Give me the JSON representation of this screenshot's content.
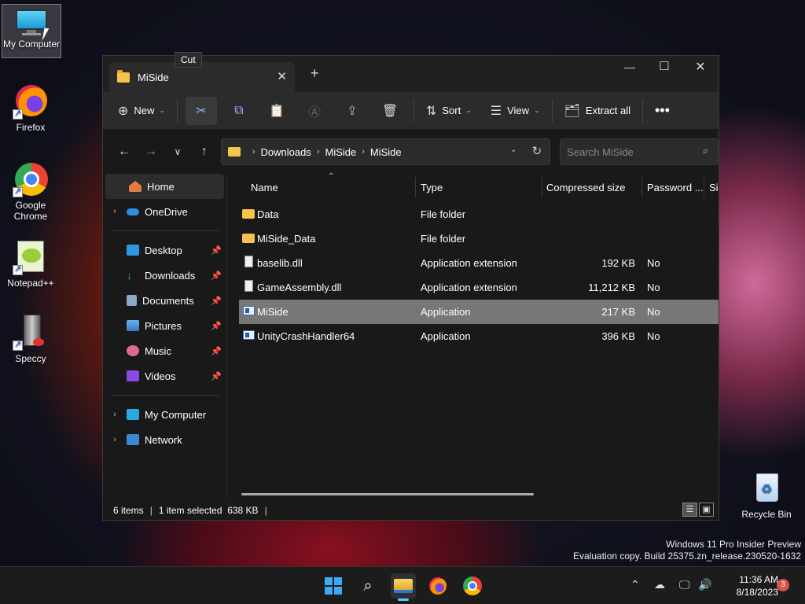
{
  "desktop": {
    "icons": [
      {
        "label": "My Computer"
      },
      {
        "label": "Firefox"
      },
      {
        "label": "Google Chrome"
      },
      {
        "label": "Notepad++"
      },
      {
        "label": "Speccy"
      }
    ],
    "recycle_bin": "Recycle Bin",
    "watermark_line1": "Windows 11 Pro Insider Preview",
    "watermark_line2": "Evaluation copy. Build 25375.zn_release.230520-1632"
  },
  "window": {
    "tab_title": "MiSide",
    "tooltip": "Cut",
    "toolbar": {
      "new_label": "New",
      "sort_label": "Sort",
      "view_label": "View",
      "extract_label": "Extract all"
    },
    "path": [
      "Downloads",
      "MiSide",
      "MiSide"
    ],
    "search_placeholder": "Search MiSide",
    "sidebar": {
      "home": "Home",
      "onedrive": "OneDrive",
      "quick": [
        "Desktop",
        "Downloads",
        "Documents",
        "Pictures",
        "Music",
        "Videos"
      ],
      "my_computer": "My Computer",
      "network": "Network"
    },
    "columns": [
      "Name",
      "Type",
      "Compressed size",
      "Password ...",
      "Si"
    ],
    "files": [
      {
        "name": "Data",
        "type": "File folder",
        "size": "",
        "password": ""
      },
      {
        "name": "MiSide_Data",
        "type": "File folder",
        "size": "",
        "password": ""
      },
      {
        "name": "baselib.dll",
        "type": "Application extension",
        "size": "192 KB",
        "password": "No"
      },
      {
        "name": "GameAssembly.dll",
        "type": "Application extension",
        "size": "11,212 KB",
        "password": "No"
      },
      {
        "name": "MiSide",
        "type": "Application",
        "size": "217 KB",
        "password": "No"
      },
      {
        "name": "UnityCrashHandler64",
        "type": "Application",
        "size": "396 KB",
        "password": "No"
      }
    ],
    "status": {
      "items": "6 items",
      "selected": "1 item selected  638 KB"
    }
  },
  "taskbar": {
    "time": "11:36 AM",
    "date": "8/18/2023",
    "notification_count": "3"
  },
  "colors": {
    "folder": "#f4c54a",
    "accent": "#60cdff",
    "selected_row": "#777777"
  }
}
